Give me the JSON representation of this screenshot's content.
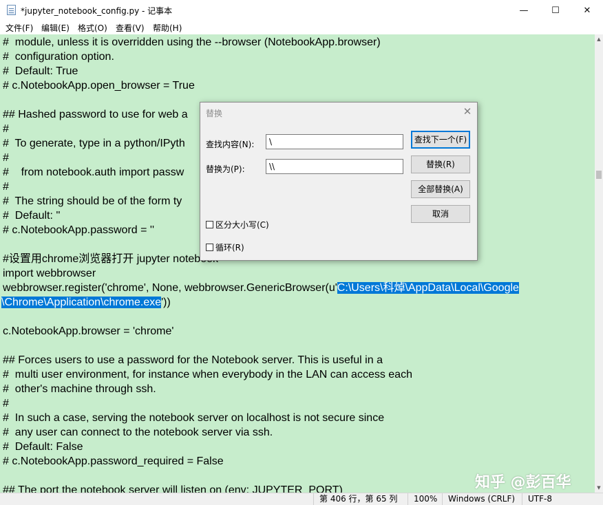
{
  "window": {
    "title": "*jupyter_notebook_config.py - 记事本",
    "minimize_glyph": "—",
    "maximize_glyph": "☐",
    "close_glyph": "✕"
  },
  "menu": {
    "items": [
      {
        "label": "文件(F)"
      },
      {
        "label": "编辑(E)"
      },
      {
        "label": "格式(O)"
      },
      {
        "label": "查看(V)"
      },
      {
        "label": "帮助(H)"
      }
    ]
  },
  "editor": {
    "background": "#c7edcc",
    "selection_color": "#0078d7",
    "lines": [
      "#  module, unless it is overridden using the --browser (NotebookApp.browser)",
      "#  configuration option.",
      "#  Default: True",
      "# c.NotebookApp.open_browser = True",
      "",
      "## Hashed password to use for web a",
      "#",
      "#  To generate, type in a python/IPyth",
      "#",
      "#    from notebook.auth import passw",
      "#",
      "#  The string should be of the form ty",
      "#  Default: ''",
      "# c.NotebookApp.password = ''",
      "",
      "#设置用chrome浏览器打开 jupyter notebook",
      "import webbrowser",
      "webbrowser.register('chrome', None, webbrowser.GenericBrowser(u'",
      "",
      "",
      "c.NotebookApp.browser = 'chrome'",
      "",
      "## Forces users to use a password for the Notebook server. This is useful in a",
      "#  multi user environment, for instance when everybody in the LAN can access each",
      "#  other's machine through ssh.",
      "#",
      "#  In such a case, serving the notebook server on localhost is not secure since",
      "#  any user can connect to the notebook server via ssh.",
      "#  Default: False",
      "# c.NotebookApp.password_required = False",
      "",
      "## The port the notebook server will listen on (env: JUPYTER_PORT)"
    ],
    "selected_part1": "C:\\Users\\科焯\\AppData\\Local\\Google",
    "selected_part2": "\\Chrome\\Application\\chrome.exe",
    "after_selection": "'))"
  },
  "dialog": {
    "title": "替换",
    "find_label": "查找内容(N):",
    "find_value": "\\",
    "replace_label": "替换为(P):",
    "replace_value": "\\\\",
    "find_next_button": "查找下一个(F)",
    "replace_button": "替换(R)",
    "replace_all_button": "全部替换(A)",
    "cancel_button": "取消",
    "match_case_label": "区分大小写(C)",
    "match_case_checked": false,
    "wrap_label": "循环(R)",
    "wrap_checked": false
  },
  "status": {
    "position": "第 406 行，第 65 列",
    "zoom": "100%",
    "line_ending": "Windows (CRLF)",
    "encoding": "UTF-8"
  },
  "watermark": "知乎 @彭百华"
}
